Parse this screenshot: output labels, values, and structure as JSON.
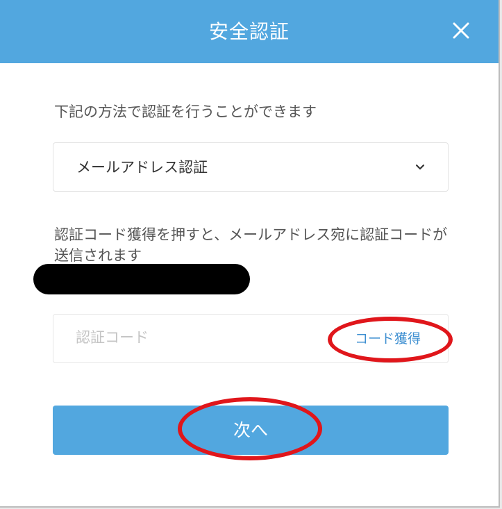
{
  "dialog": {
    "title": "安全認証",
    "close_icon": "close-icon"
  },
  "colors": {
    "header": "#52a7df",
    "link": "#3e8fd1",
    "annotation": "#e0161b",
    "redaction": "#000000"
  },
  "body": {
    "description": "下記の方法で認証を行うことができます",
    "method_select": {
      "value": "メールアドレス認証",
      "icon": "chevron-down-icon"
    },
    "info_text": "認証コード獲得を押すと、メールアドレス宛に認証コードが送信されます",
    "code_field": {
      "value": "",
      "placeholder": "認証コード"
    },
    "get_code_label": "コード獲得",
    "next_label": "次へ"
  }
}
